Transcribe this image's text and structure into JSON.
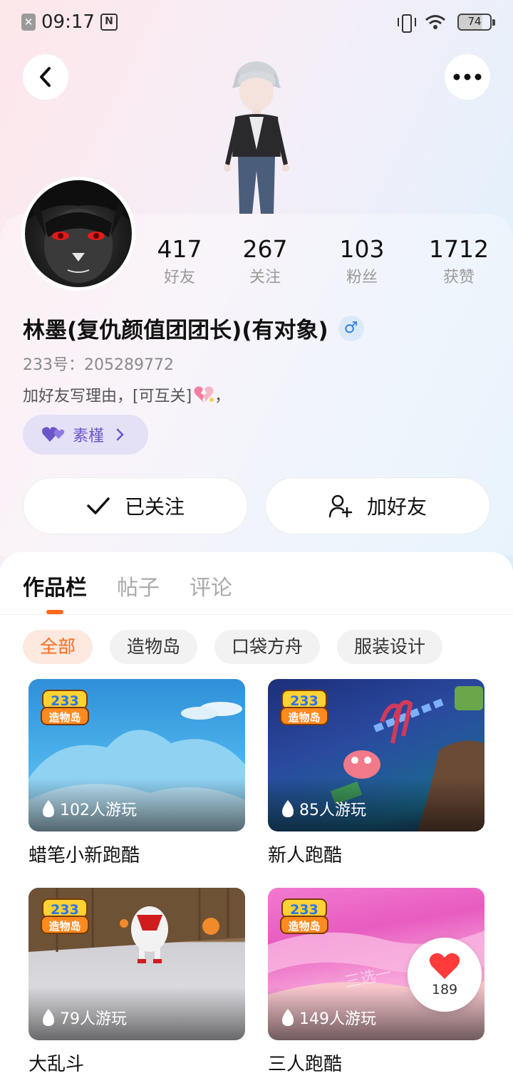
{
  "status_bar": {
    "time": "09:17",
    "battery": "74"
  },
  "profile": {
    "stats": [
      {
        "value": "417",
        "label": "好友"
      },
      {
        "value": "267",
        "label": "关注"
      },
      {
        "value": "103",
        "label": "粉丝"
      },
      {
        "value": "1712",
        "label": "获赞"
      }
    ],
    "name": "林墨(复仇颜值团团长)(有对象)",
    "gender_symbol": "♂",
    "uid": "233号：205289772",
    "bio": "加好友写理由，[可互关]",
    "bio_suffix": "，",
    "tag_label": "素槿"
  },
  "actions": {
    "follow_label": "已关注",
    "add_friend_label": "加好友"
  },
  "tabs": [
    {
      "label": "作品栏",
      "active": true
    },
    {
      "label": "帖子",
      "active": false
    },
    {
      "label": "评论",
      "active": false
    }
  ],
  "chips": [
    {
      "label": "全部",
      "active": true
    },
    {
      "label": "造物岛",
      "active": false
    },
    {
      "label": "口袋方舟",
      "active": false
    },
    {
      "label": "服装设计",
      "active": false
    }
  ],
  "games": [
    {
      "title": "蜡笔小新跑酷",
      "plays": "102人游玩",
      "logo_text_top": "233",
      "logo_text_bottom": "造物岛"
    },
    {
      "title": "新人跑酷",
      "plays": "85人游玩",
      "logo_text_top": "233",
      "logo_text_bottom": "造物岛"
    },
    {
      "title": "大乱斗",
      "plays": "79人游玩",
      "logo_text_top": "233",
      "logo_text_bottom": "造物岛"
    },
    {
      "title": "三人跑酷",
      "plays": "149人游玩",
      "logo_text_top": "233",
      "logo_text_bottom": "造物岛",
      "watermark": "三选一"
    }
  ],
  "like_fab": {
    "count": "189"
  },
  "colors": {
    "accent": "#ff6a1a",
    "tag_purple": "#6b55c9",
    "heart_red": "#ff3b3b"
  }
}
